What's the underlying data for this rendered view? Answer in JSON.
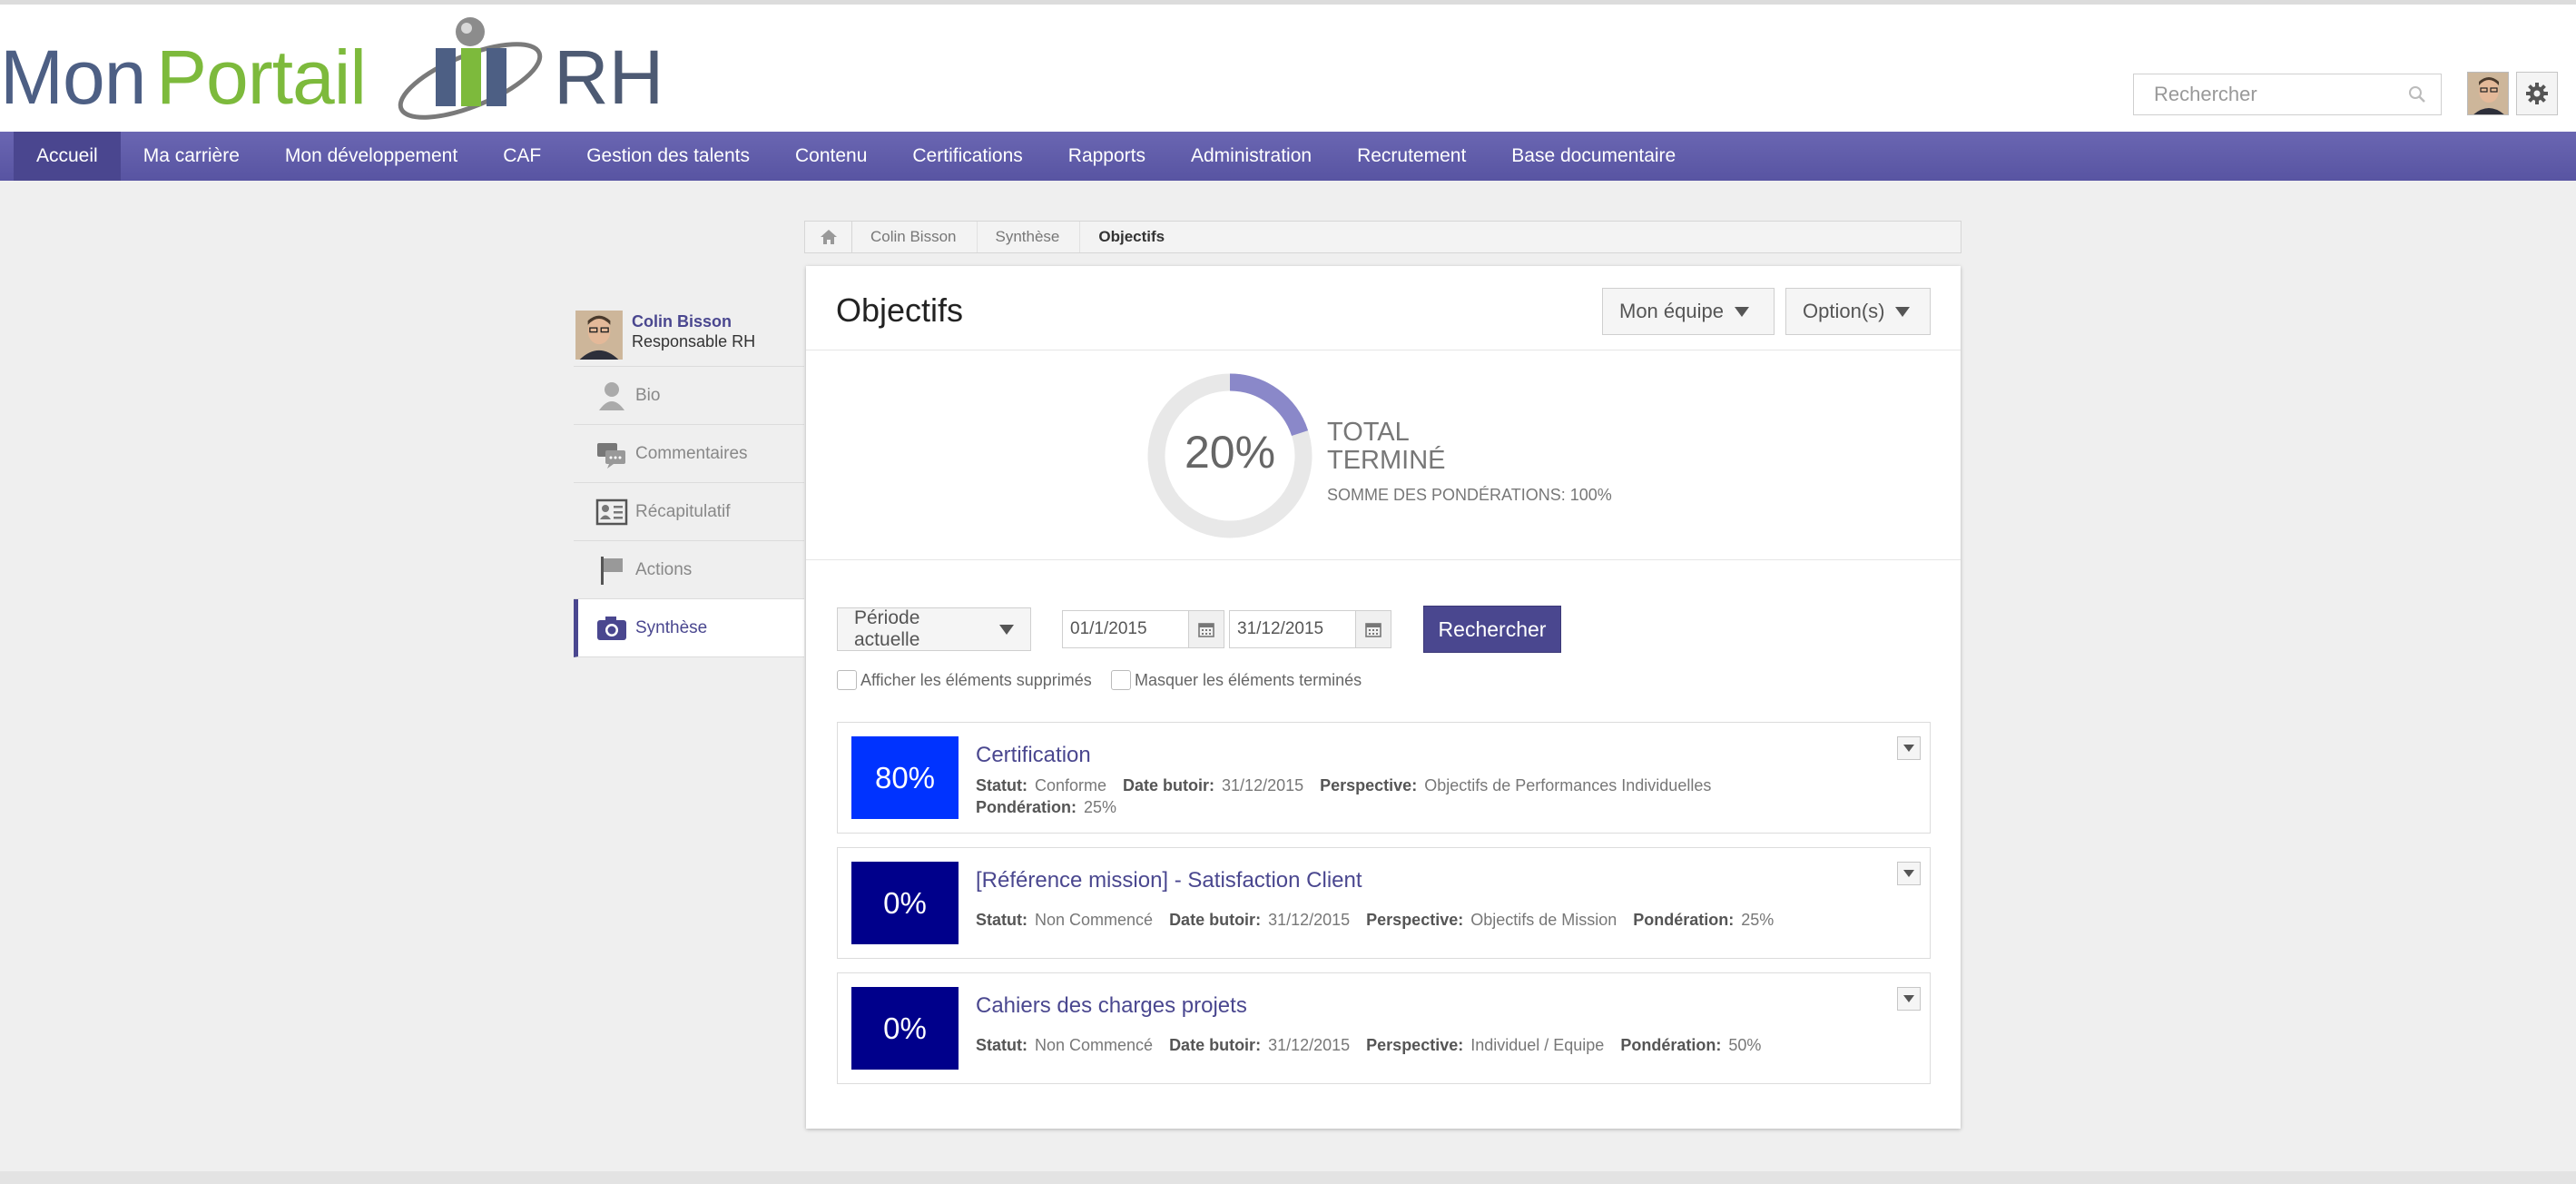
{
  "app": {
    "logo": {
      "part1": "Mon",
      "part2": "Portail",
      "part3": "RH"
    },
    "search_placeholder": "Rechercher"
  },
  "nav": {
    "items": [
      "Accueil",
      "Ma carrière",
      "Mon développement",
      "CAF",
      "Gestion des talents",
      "Contenu",
      "Certifications",
      "Rapports",
      "Administration",
      "Recrutement",
      "Base documentaire"
    ],
    "active_index": 0
  },
  "breadcrumb": {
    "home_icon": "home-icon",
    "items": [
      "Colin Bisson",
      "Synthèse",
      "Objectifs"
    ]
  },
  "profile": {
    "name": "Colin Bisson",
    "role": "Responsable RH",
    "menu": [
      {
        "label": "Bio",
        "icon": "person-icon"
      },
      {
        "label": "Commentaires",
        "icon": "comments-icon"
      },
      {
        "label": "Récapitulatif",
        "icon": "id-card-icon"
      },
      {
        "label": "Actions",
        "icon": "flag-icon"
      },
      {
        "label": "Synthèse",
        "icon": "camera-icon"
      }
    ],
    "active_label": "Synthèse"
  },
  "main": {
    "title": "Objectifs",
    "team_button": "Mon équipe",
    "options_button": "Option(s)",
    "summary": {
      "percent_value": 20,
      "percent_label": "20%",
      "total_label_1": "TOTAL",
      "total_label_2": "TERMINÉ",
      "weights_label": "SOMME DES PONDÉRATIONS: 100%"
    },
    "filters": {
      "period": "Période actuelle",
      "start_date": "01/1/2015",
      "end_date": "31/12/2015",
      "search_button": "Rechercher",
      "show_deleted": "Afficher les éléments supprimés",
      "hide_completed": "Masquer les éléments terminés"
    },
    "objectives": [
      {
        "percent": "80%",
        "color": "#0033ff",
        "title": "Certification",
        "statut_label": "Statut:",
        "statut": "Conforme",
        "date_label": "Date butoir:",
        "date": "31/12/2015",
        "perspective_label": "Perspective:",
        "perspective": "Objectifs de Performances Individuelles",
        "ponderation_label": "Pondération:",
        "ponderation": "25%"
      },
      {
        "percent": "0%",
        "color": "#00008b",
        "title": "[Référence mission] - Satisfaction Client",
        "statut_label": "Statut:",
        "statut": "Non Commencé",
        "date_label": "Date butoir:",
        "date": "31/12/2015",
        "perspective_label": "Perspective:",
        "perspective": "Objectifs de Mission",
        "ponderation_label": "Pondération:",
        "ponderation": "25%"
      },
      {
        "percent": "0%",
        "color": "#00008b",
        "title": "Cahiers des charges projets",
        "statut_label": "Statut:",
        "statut": "Non Commencé",
        "date_label": "Date butoir:",
        "date": "31/12/2015",
        "perspective_label": "Perspective:",
        "perspective": "Individuel / Equipe",
        "ponderation_label": "Pondération:",
        "ponderation": "50%"
      }
    ]
  },
  "colors": {
    "nav": "#5f5baa",
    "accent": "#4a478f",
    "donut_fill": "#8a88c9",
    "donut_track": "#e8e8e8"
  }
}
